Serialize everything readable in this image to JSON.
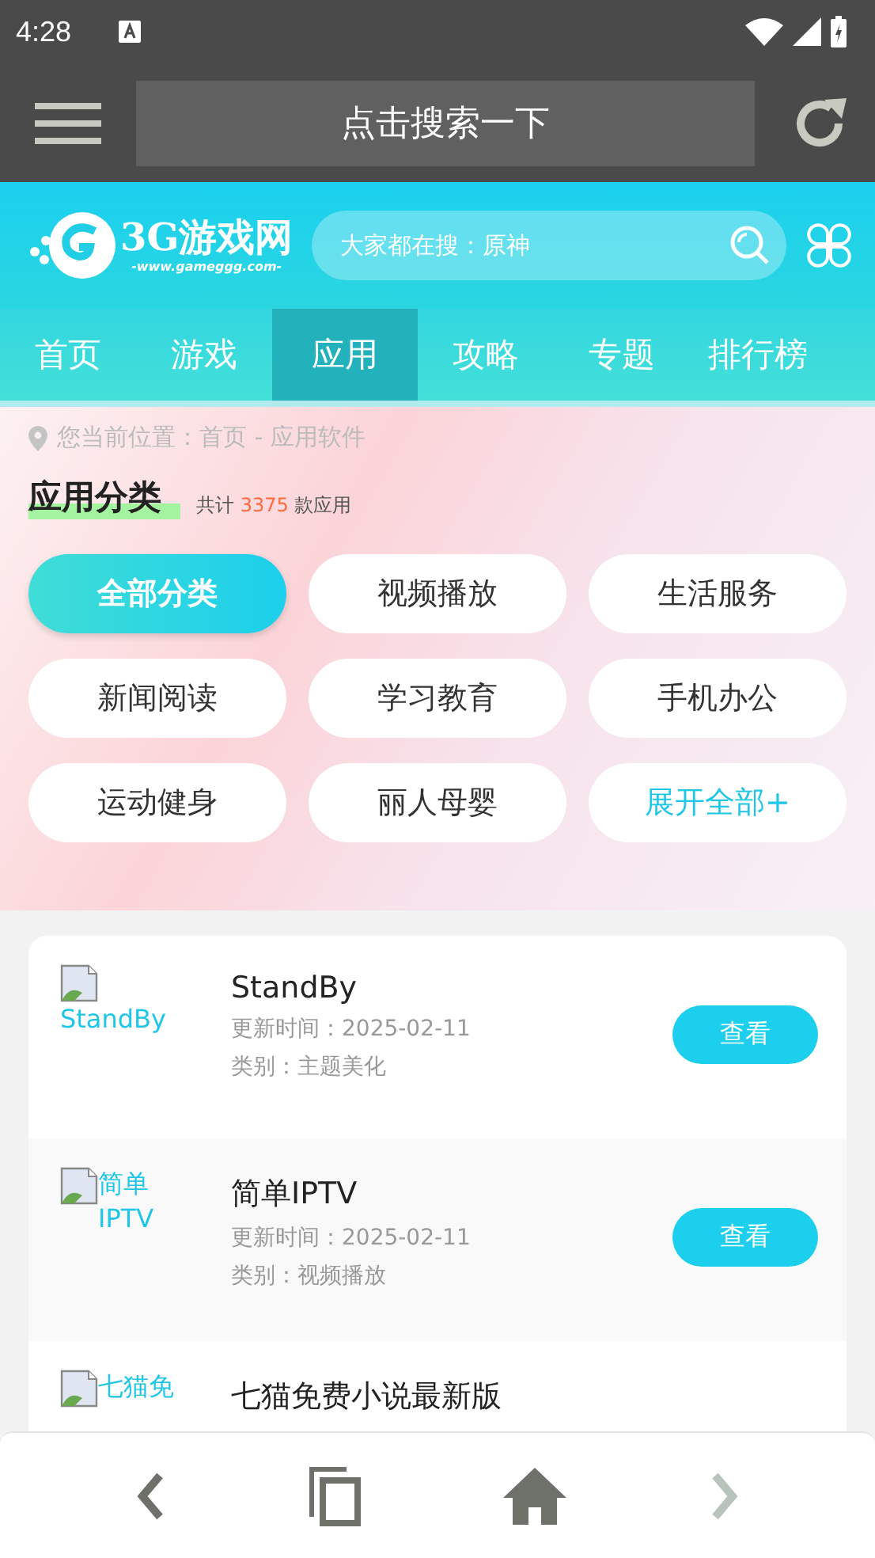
{
  "status_bar": {
    "time": "4:28"
  },
  "toolbar": {
    "search_text": "点击搜索一下"
  },
  "header": {
    "logo_title": "3G游戏网",
    "logo_subtitle": "-www.gameggg.com-",
    "search_placeholder": "大家都在搜：原神"
  },
  "tabs": [
    {
      "label": "首页",
      "selected": false
    },
    {
      "label": "游戏",
      "selected": false
    },
    {
      "label": "应用",
      "selected": true
    },
    {
      "label": "攻略",
      "selected": false
    },
    {
      "label": "专题",
      "selected": false
    },
    {
      "label": "排行榜",
      "selected": false
    }
  ],
  "breadcrumb": "您当前位置：首页 - 应用软件",
  "section": {
    "title": "应用分类",
    "count_prefix": "共计",
    "count": "3375",
    "count_suffix": "款应用"
  },
  "categories": [
    {
      "label": "全部分类",
      "kind": "category",
      "selected": true
    },
    {
      "label": "视频播放",
      "kind": "category",
      "selected": false
    },
    {
      "label": "生活服务",
      "kind": "category",
      "selected": false
    },
    {
      "label": "新闻阅读",
      "kind": "category",
      "selected": false
    },
    {
      "label": "学习教育",
      "kind": "category",
      "selected": false
    },
    {
      "label": "手机办公",
      "kind": "category",
      "selected": false
    },
    {
      "label": "运动健身",
      "kind": "category",
      "selected": false
    },
    {
      "label": "丽人母婴",
      "kind": "category",
      "selected": false
    },
    {
      "label": "展开全部+",
      "kind": "expand",
      "selected": false
    }
  ],
  "apps": [
    {
      "image_alt": "StandBy",
      "name": "StandBy",
      "updated": "更新时间：2025-02-11",
      "category": "类别：主题美化",
      "button": "查看"
    },
    {
      "image_alt": "简单IPTV",
      "name": "简单IPTV",
      "updated": "更新时间：2025-02-11",
      "category": "类别：视频播放",
      "button": "查看"
    },
    {
      "image_alt": "七猫免",
      "name": "七猫免费小说最新版"
    }
  ]
}
